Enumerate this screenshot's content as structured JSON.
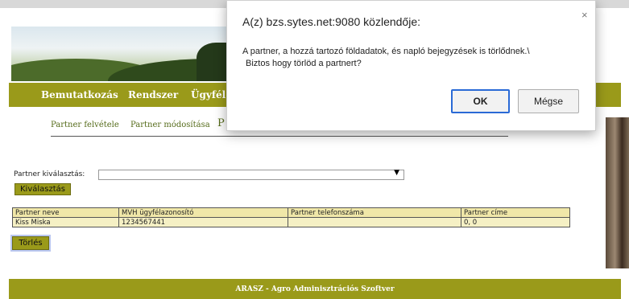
{
  "nav": {
    "items": [
      "Bemutatkozás",
      "Rendszer",
      "Ügyfél"
    ]
  },
  "subnav": {
    "items": [
      "Partner felvétele",
      "Partner módosítása",
      "P"
    ]
  },
  "form": {
    "select_label": "Partner kiválasztás:",
    "select_value": "",
    "select_button": "Kiválasztás",
    "delete_button": "Törlés"
  },
  "table": {
    "headers": [
      "Partner neve",
      "MVH ügyfélazonosító",
      "Partner telefonszáma",
      "Partner címe"
    ],
    "rows": [
      [
        "Kiss Miska",
        "1234567441",
        "",
        "0,  0"
      ]
    ]
  },
  "footer": {
    "text": "ARASZ - Agro Adminisztrációs Szoftver"
  },
  "dialog": {
    "title": "A(z) bzs.sytes.net:9080 közlendője:",
    "close_icon": "×",
    "message_line1": "A partner, a hozzá tartozó földadatok, és napló bejegyzések is törlődnek.\\",
    "message_line2": "Biztos hogy törlöd a partnert?",
    "ok_label": "OK",
    "cancel_label": "Mégse"
  }
}
